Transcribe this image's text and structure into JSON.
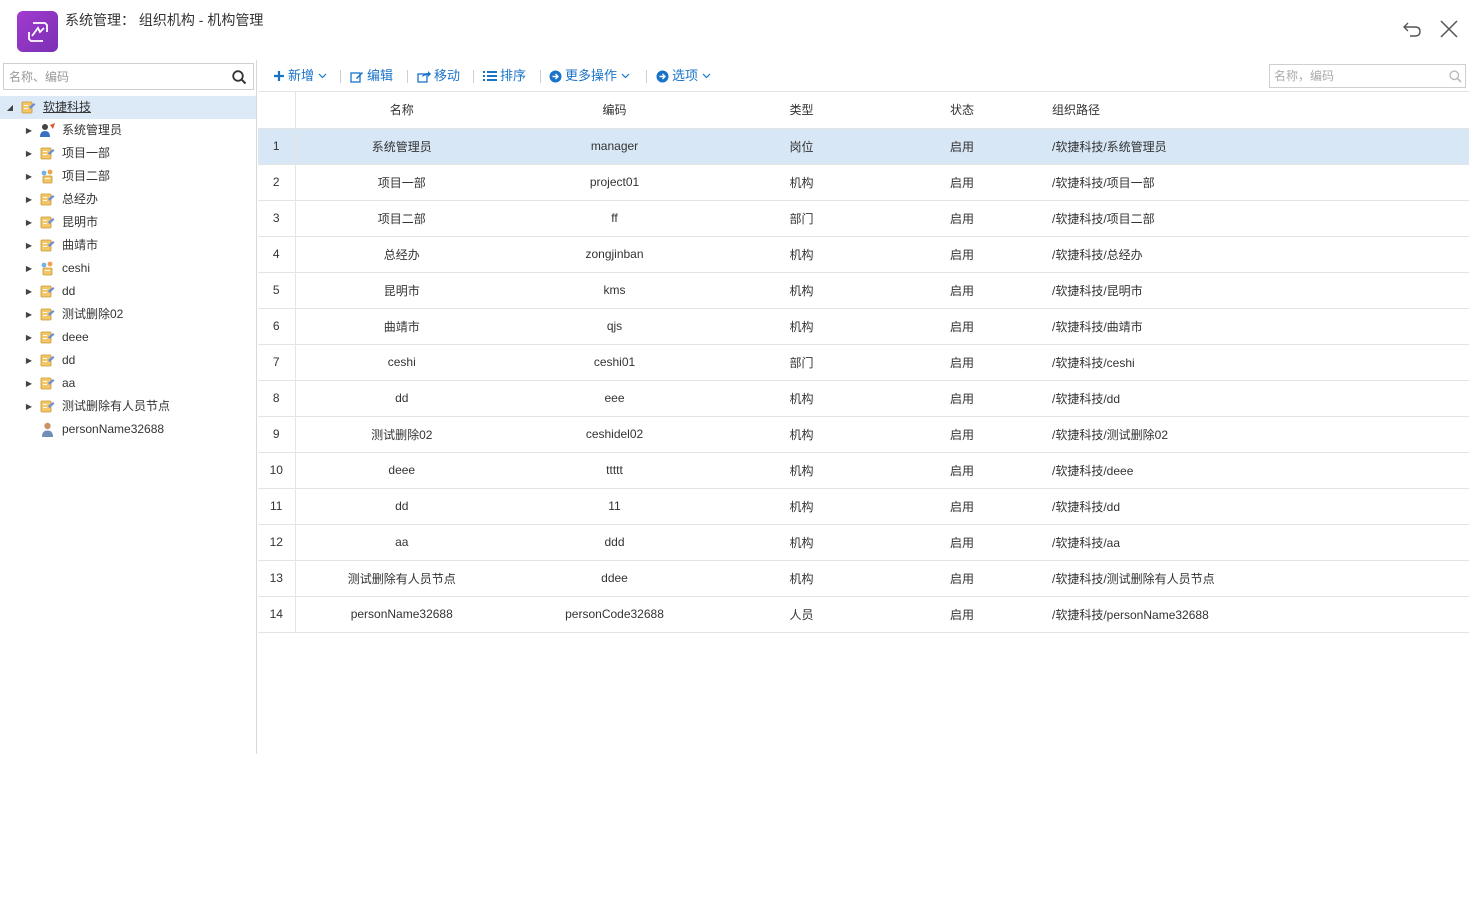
{
  "window": {
    "title": "系统管理：  组织机构 - 机构管理",
    "logo_icon": "app-logo-icon",
    "back_icon": "undo-icon",
    "close_icon": "close-icon",
    "accent": "#1a73c9",
    "logo_color": "#8e35c4"
  },
  "left_search": {
    "placeholder": "名称、编码"
  },
  "tree": {
    "root": {
      "label": "软捷科技",
      "icon": "org-icon"
    },
    "children": [
      {
        "label": "系统管理员",
        "icon": "admin-position-icon"
      },
      {
        "label": "项目一部",
        "icon": "org-icon"
      },
      {
        "label": "项目二部",
        "icon": "dept-icon"
      },
      {
        "label": "总经办",
        "icon": "org-icon"
      },
      {
        "label": "昆明市",
        "icon": "org-icon"
      },
      {
        "label": "曲靖市",
        "icon": "org-icon"
      },
      {
        "label": "ceshi",
        "icon": "dept-icon"
      },
      {
        "label": "dd",
        "icon": "org-icon"
      },
      {
        "label": "测试删除02",
        "icon": "org-icon"
      },
      {
        "label": "deee",
        "icon": "org-icon"
      },
      {
        "label": "dd",
        "icon": "org-icon"
      },
      {
        "label": "aa",
        "icon": "org-icon"
      },
      {
        "label": "测试删除有人员节点",
        "icon": "org-icon"
      },
      {
        "label": "personName32688",
        "icon": "person-icon"
      }
    ]
  },
  "toolbar": {
    "add": "新增",
    "edit": "编辑",
    "move": "移动",
    "sort": "排序",
    "more": "更多操作",
    "options": "选项",
    "search_placeholder": "名称，编码"
  },
  "grid": {
    "columns": [
      "名称",
      "编码",
      "类型",
      "状态",
      "组织路径"
    ],
    "rows": [
      {
        "num": "1",
        "name": "系统管理员",
        "code": "manager",
        "type": "岗位",
        "status": "启用",
        "path": "/软捷科技/系统管理员"
      },
      {
        "num": "2",
        "name": "项目一部",
        "code": "project01",
        "type": "机构",
        "status": "启用",
        "path": "/软捷科技/项目一部"
      },
      {
        "num": "3",
        "name": "项目二部",
        "code": "ff",
        "type": "部门",
        "status": "启用",
        "path": "/软捷科技/项目二部"
      },
      {
        "num": "4",
        "name": "总经办",
        "code": "zongjinban",
        "type": "机构",
        "status": "启用",
        "path": "/软捷科技/总经办"
      },
      {
        "num": "5",
        "name": "昆明市",
        "code": "kms",
        "type": "机构",
        "status": "启用",
        "path": "/软捷科技/昆明市"
      },
      {
        "num": "6",
        "name": "曲靖市",
        "code": "qjs",
        "type": "机构",
        "status": "启用",
        "path": "/软捷科技/曲靖市"
      },
      {
        "num": "7",
        "name": "ceshi",
        "code": "ceshi01",
        "type": "部门",
        "status": "启用",
        "path": "/软捷科技/ceshi"
      },
      {
        "num": "8",
        "name": "dd",
        "code": "eee",
        "type": "机构",
        "status": "启用",
        "path": "/软捷科技/dd"
      },
      {
        "num": "9",
        "name": "测试删除02",
        "code": "ceshidel02",
        "type": "机构",
        "status": "启用",
        "path": "/软捷科技/测试删除02"
      },
      {
        "num": "10",
        "name": "deee",
        "code": "ttttt",
        "type": "机构",
        "status": "启用",
        "path": "/软捷科技/deee"
      },
      {
        "num": "11",
        "name": "dd",
        "code": "11",
        "type": "机构",
        "status": "启用",
        "path": "/软捷科技/dd"
      },
      {
        "num": "12",
        "name": "aa",
        "code": "ddd",
        "type": "机构",
        "status": "启用",
        "path": "/软捷科技/aa"
      },
      {
        "num": "13",
        "name": "测试删除有人员节点",
        "code": "ddee",
        "type": "机构",
        "status": "启用",
        "path": "/软捷科技/测试删除有人员节点"
      },
      {
        "num": "14",
        "name": "personName32688",
        "code": "personCode32688",
        "type": "人员",
        "status": "启用",
        "path": "/软捷科技/personName32688"
      }
    ]
  }
}
